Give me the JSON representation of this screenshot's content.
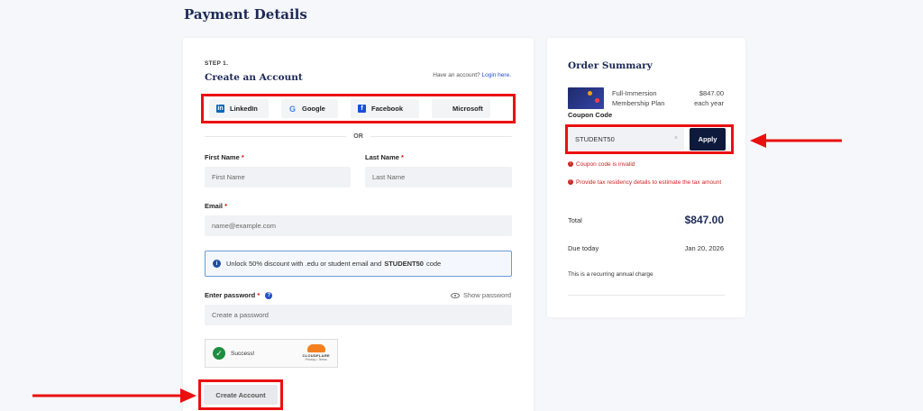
{
  "page_title": "Payment Details",
  "account": {
    "step": "STEP 1.",
    "title": "Create an Account",
    "have_account_text": "Have an account?",
    "login_link": "Login here.",
    "social": [
      {
        "label": "LinkedIn",
        "icon": "linkedin-icon"
      },
      {
        "label": "Google",
        "icon": "google-icon"
      },
      {
        "label": "Facebook",
        "icon": "facebook-icon"
      },
      {
        "label": "Microsoft",
        "icon": "microsoft-icon"
      }
    ],
    "or_text": "OR",
    "first_name": {
      "label": "First Name",
      "placeholder": "First Name"
    },
    "last_name": {
      "label": "Last Name",
      "placeholder": "Last Name"
    },
    "required_mark": "*",
    "email": {
      "label": "Email",
      "placeholder": "name@example.com"
    },
    "info_text_before": "Unlock 50% discount with .edu or student email and",
    "info_code": "STUDENT50",
    "info_text_after": "code",
    "password": {
      "label": "Enter password",
      "placeholder": "Create a password",
      "show_label": "Show password"
    },
    "captcha": {
      "status": "Success!",
      "brand": "CLOUDFLARE",
      "links": "Privacy • Terms"
    },
    "create_button": "Create Account"
  },
  "order": {
    "title": "Order Summary",
    "plan_name_line1": "Full-Immersion",
    "plan_name_line2": "Membership Plan",
    "plan_price": "$847.00",
    "plan_period": "each year",
    "coupon_label": "Coupon Code",
    "coupon_value": "STUDENT50",
    "clear_glyph": "×",
    "apply_button": "Apply",
    "error_invalid": "Coupon code is invalid",
    "error_tax": "Provide tax residency details to estimate the tax amount",
    "total_label": "Total",
    "total_value": "$847.00",
    "due_label": "Due today",
    "due_value": "Jan 20, 2026",
    "recurring_note": "This is a recurring annual charge"
  },
  "colors": {
    "highlight": "#ea1010",
    "navy": "#1d2a57",
    "apply_bg": "#0e1a3c",
    "error": "#c22"
  }
}
